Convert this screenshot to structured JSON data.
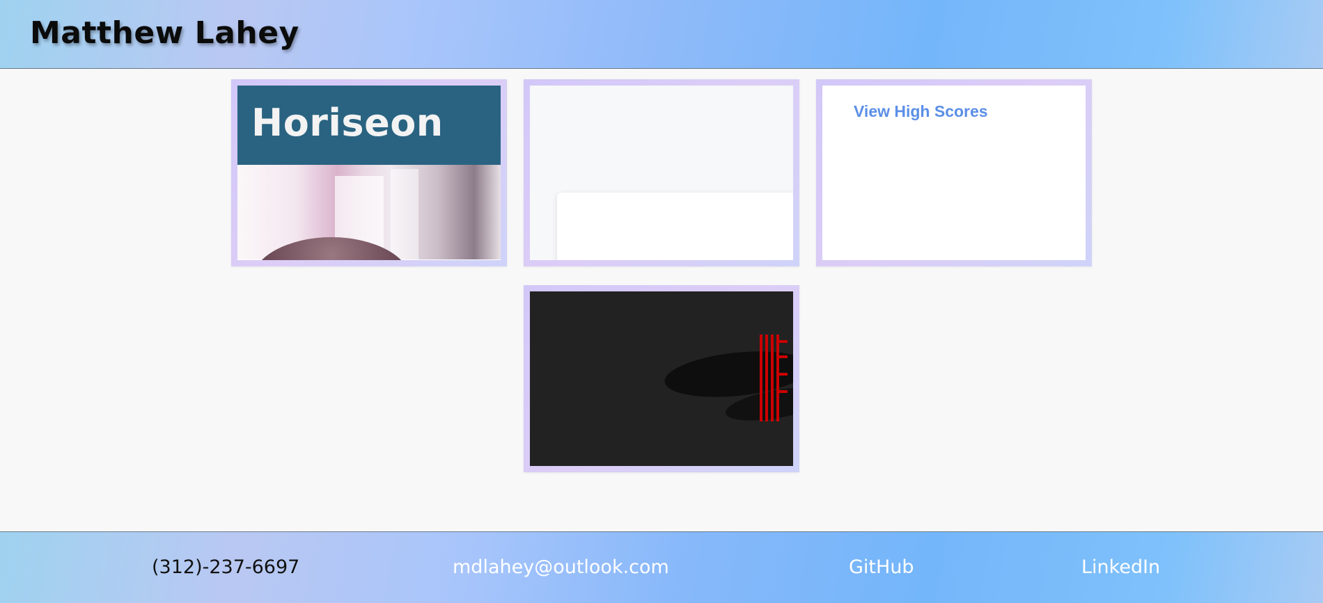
{
  "header": {
    "title": "Matthew Lahey"
  },
  "projects": [
    {
      "label": "Horiseon",
      "caption": ""
    },
    {
      "label": "",
      "caption": ""
    },
    {
      "label": "View High Scores",
      "caption": ""
    },
    {
      "label": "",
      "caption": ""
    }
  ],
  "footer": {
    "phone": "(312)-237-6697",
    "email": "mdlahey@outlook.com",
    "github": "GitHub",
    "linkedin": "LinkedIn"
  },
  "colors": {
    "card_border": "#d6ccf8",
    "horiseon_banner": "#2a6381",
    "high_scores_link": "#5b8fe6",
    "dark_thumb": "#222222",
    "accent_red": "#cc0000"
  }
}
